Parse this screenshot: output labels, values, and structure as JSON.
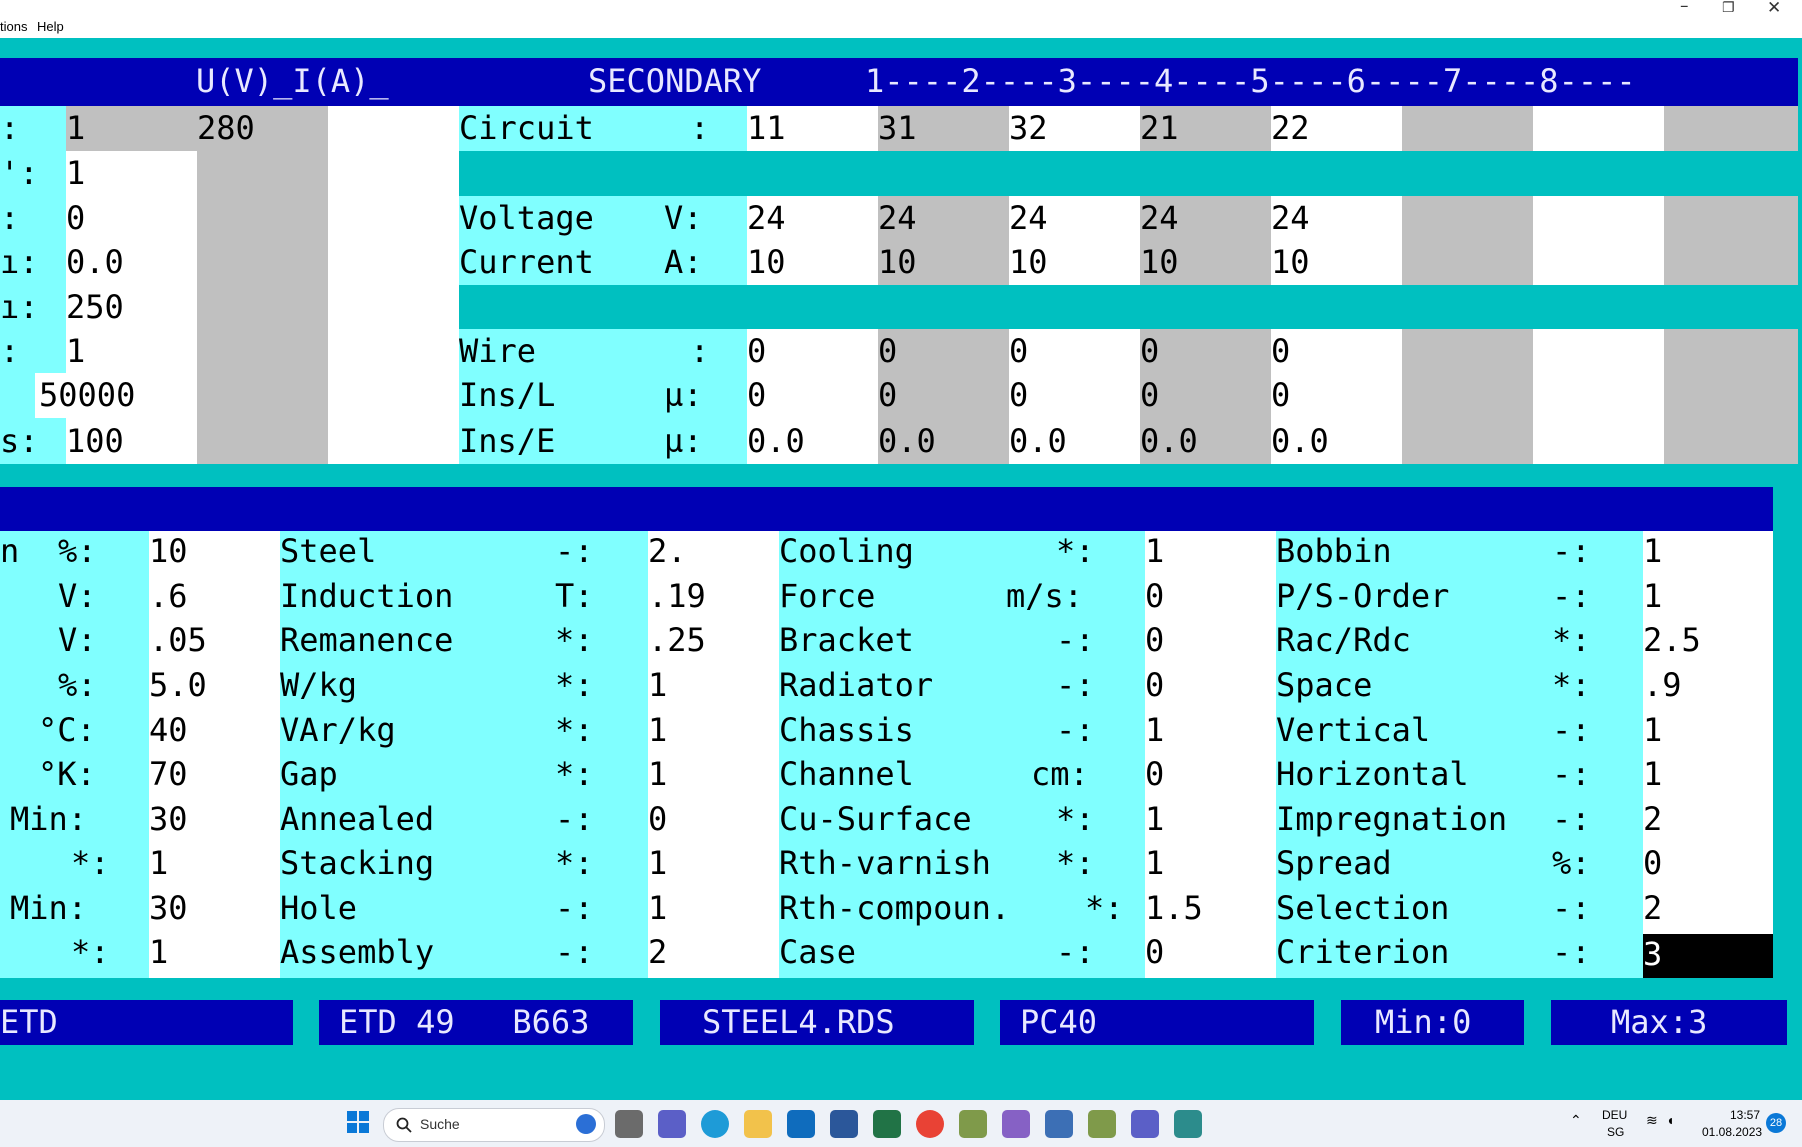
{
  "menubar": {
    "items": [
      "tions",
      "Help"
    ],
    "window_controls": [
      "–",
      "❐",
      "✕"
    ]
  },
  "header": {
    "u_i_label": "U(V)_I(A)_",
    "secondary_label": "SECONDARY",
    "scale": "1----2----3----4----5----6----7----8----"
  },
  "primary_left": {
    "labels": [
      ":",
      "':",
      ":",
      "ı:",
      "ı:",
      ":",
      "",
      "s:"
    ],
    "values": [
      "1",
      "1",
      "0",
      "0.0",
      "250",
      "1",
      "50000",
      "100"
    ],
    "value_top_right": "280"
  },
  "secondary": {
    "circuit_label": "Circuit",
    "circuit_unit": ":",
    "circuits": [
      "11",
      "31",
      "32",
      "21",
      "22",
      "",
      "",
      ""
    ],
    "voltage_label": "Voltage",
    "voltage_unit": "V:",
    "voltages": [
      "24",
      "24",
      "24",
      "24",
      "24",
      "",
      "",
      ""
    ],
    "current_label": "Current",
    "current_unit": "A:",
    "currents": [
      "10",
      "10",
      "10",
      "10",
      "10",
      "",
      "",
      ""
    ],
    "wire_label": "Wire",
    "wire_unit": ":",
    "wires": [
      "0",
      "0",
      "0",
      "0",
      "0",
      "",
      "",
      ""
    ],
    "insl_label": "Ins/L",
    "insl_unit": "µ:",
    "insl": [
      "0",
      "0",
      "0",
      "0",
      "0",
      "",
      "",
      ""
    ],
    "inse_label": "Ins/E",
    "inse_unit": "µ:",
    "inse": [
      "0.0",
      "0.0",
      "0.0",
      "0.0",
      "0.0",
      "",
      "",
      ""
    ]
  },
  "params": {
    "col1": [
      {
        "label": "n",
        "unit": "%:",
        "value": "10"
      },
      {
        "label": "",
        "unit": "V:",
        "value": ".6"
      },
      {
        "label": "",
        "unit": "V:",
        "value": ".05"
      },
      {
        "label": "",
        "unit": "%:",
        "value": "5.0"
      },
      {
        "label": "",
        "unit": "°C:",
        "value": "40"
      },
      {
        "label": "",
        "unit": "°K:",
        "value": "70"
      },
      {
        "label": "",
        "unit": "Min:",
        "value": "30"
      },
      {
        "label": "",
        "unit": "*:",
        "value": "1"
      },
      {
        "label": "",
        "unit": "Min:",
        "value": "30"
      },
      {
        "label": "",
        "unit": "*:",
        "value": "1"
      }
    ],
    "col2": [
      {
        "label": "Steel",
        "unit": "-:",
        "value": "2."
      },
      {
        "label": "Induction",
        "unit": "T:",
        "value": ".19"
      },
      {
        "label": "Remanence",
        "unit": "*:",
        "value": ".25"
      },
      {
        "label": "W/kg",
        "unit": "*:",
        "value": "1"
      },
      {
        "label": "VAr/kg",
        "unit": "*:",
        "value": "1"
      },
      {
        "label": "Gap",
        "unit": "*:",
        "value": "1"
      },
      {
        "label": "Annealed",
        "unit": "-:",
        "value": "0"
      },
      {
        "label": "Stacking",
        "unit": "*:",
        "value": "1"
      },
      {
        "label": "Hole",
        "unit": "-:",
        "value": "1"
      },
      {
        "label": "Assembly",
        "unit": "-:",
        "value": "2"
      }
    ],
    "col3": [
      {
        "label": "Cooling",
        "unit": "*:",
        "value": "1"
      },
      {
        "label": "Force",
        "unit": "m/s:",
        "value": "0"
      },
      {
        "label": "Bracket",
        "unit": "-:",
        "value": "0"
      },
      {
        "label": "Radiator",
        "unit": "-:",
        "value": "0"
      },
      {
        "label": "Chassis",
        "unit": "-:",
        "value": "1"
      },
      {
        "label": "Channel",
        "unit": "cm:",
        "value": "0"
      },
      {
        "label": "Cu-Surface",
        "unit": "*:",
        "value": "1"
      },
      {
        "label": "Rth-varnish",
        "unit": "*:",
        "value": "1"
      },
      {
        "label": "Rth-compoun.",
        "unit": "*:",
        "value": "1.5"
      },
      {
        "label": "Case",
        "unit": "-:",
        "value": "0"
      }
    ],
    "col4": [
      {
        "label": "Bobbin",
        "unit": "-:",
        "value": "1"
      },
      {
        "label": "P/S-Order",
        "unit": "-:",
        "value": "1"
      },
      {
        "label": "Rac/Rdc",
        "unit": "*:",
        "value": "2.5"
      },
      {
        "label": "Space",
        "unit": "*:",
        "value": ".9"
      },
      {
        "label": "Vertical",
        "unit": "-:",
        "value": "1"
      },
      {
        "label": "Horizontal",
        "unit": "-:",
        "value": "1"
      },
      {
        "label": "Impregnation",
        "unit": "-:",
        "value": "2"
      },
      {
        "label": "Spread",
        "unit": "%:",
        "value": "0"
      },
      {
        "label": "Selection",
        "unit": "-:",
        "value": "2"
      },
      {
        "label": "Criterion",
        "unit": "-:",
        "value": "3"
      }
    ]
  },
  "status": {
    "core_type": "ETD",
    "core": "ETD 49   B663",
    "steel_file": "STEEL4.RDS",
    "material": "PC40",
    "min": "Min:0",
    "max": "Max:3"
  },
  "taskbar": {
    "search_placeholder": "Suche",
    "lang": "DEU",
    "lang_sub": "SG",
    "time": "13:57",
    "date": "01.08.2023",
    "notif_count": "28",
    "colors": {
      "accent": "#0000B4",
      "panel": "#80FFFF",
      "frame": "#00C0C0"
    }
  }
}
